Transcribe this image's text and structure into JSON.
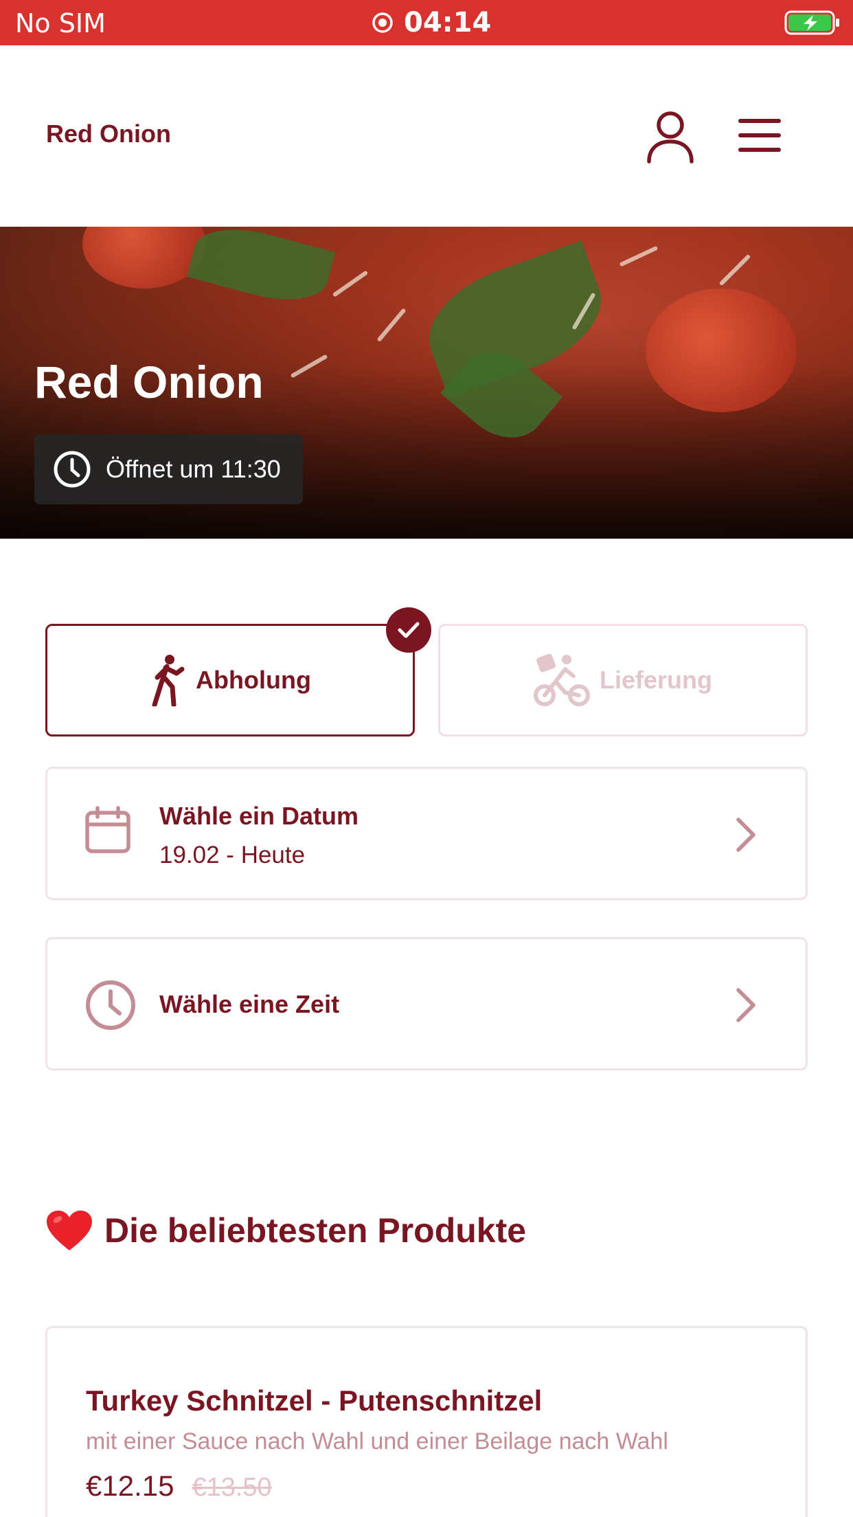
{
  "status_bar": {
    "carrier": "No SIM",
    "time": "04:14"
  },
  "header": {
    "brand": "Red Onion"
  },
  "hero": {
    "title": "Red Onion",
    "hours": "Öffnet um 11:30"
  },
  "order_modes": [
    {
      "label": "Abholung",
      "selected": true,
      "icon": "walking-person-icon"
    },
    {
      "label": "Lieferung",
      "selected": false,
      "icon": "delivery-bike-icon"
    }
  ],
  "date_select": {
    "title": "Wähle ein Datum",
    "value": "19.02 - Heute"
  },
  "time_select": {
    "title": "Wähle eine Zeit"
  },
  "popular": {
    "title": "Die beliebtesten Produkte",
    "products": [
      {
        "name": "Turkey Schnitzel - Putenschnitzel",
        "description": "mit einer Sauce nach Wahl und einer Beilage nach Wahl",
        "price": "€12.15",
        "old_price": "€13.50"
      }
    ]
  },
  "colors": {
    "brand": "#7a1622",
    "status_bar": "#d8322e",
    "muted": "#c48d95"
  }
}
